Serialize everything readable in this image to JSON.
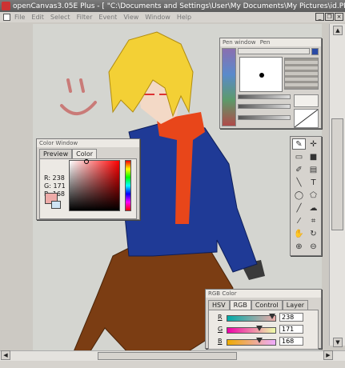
{
  "window": {
    "title": "openCanvas3.05E Plus - [ \"C:\\Documents and Settings\\User\\My Documents\\My Pictures\\id.PN…"
  },
  "menu": {
    "items": [
      "File",
      "Edit",
      "Select",
      "Filter",
      "Event",
      "View",
      "Window",
      "Help"
    ]
  },
  "window_buttons": {
    "minimize": "_",
    "restore": "❐",
    "close": "×"
  },
  "color_window": {
    "title": "Color Window",
    "tabs": [
      "Preview",
      "Color"
    ],
    "active_tab": "Color",
    "r_label": "R: 238",
    "g_label": "G: 171",
    "b_label": "B: 168",
    "current_color": "#eeaba8"
  },
  "pen_window": {
    "title": "Pen window",
    "pen_label": "Pen"
  },
  "rgb_panel": {
    "title": "RGB Color",
    "tabs": [
      "HSV",
      "RGB",
      "Control",
      "Layer"
    ],
    "active_tab": "RGB",
    "sliders": [
      {
        "label": "R",
        "value": "238",
        "fraction": 0.933
      },
      {
        "label": "G",
        "value": "171",
        "fraction": 0.671
      },
      {
        "label": "B",
        "value": "168",
        "fraction": 0.659
      }
    ]
  },
  "tools": [
    "pen-tool",
    "move-tool",
    "rect-select-tool",
    "fill-tool",
    "brush-tool",
    "gradient-tool",
    "line-tool",
    "text-tool",
    "lasso-tool",
    "polygon-tool",
    "ruler-tool",
    "smudge-tool",
    "eyedropper-tool",
    "crop-tool",
    "hand-tool",
    "rotate-tool",
    "zoom-in-tool",
    "zoom-out-tool"
  ],
  "colors": {
    "accent": "#eeaba8",
    "canvas_bg": "#d4d5d0",
    "panel_bg": "#d6d3ce"
  }
}
